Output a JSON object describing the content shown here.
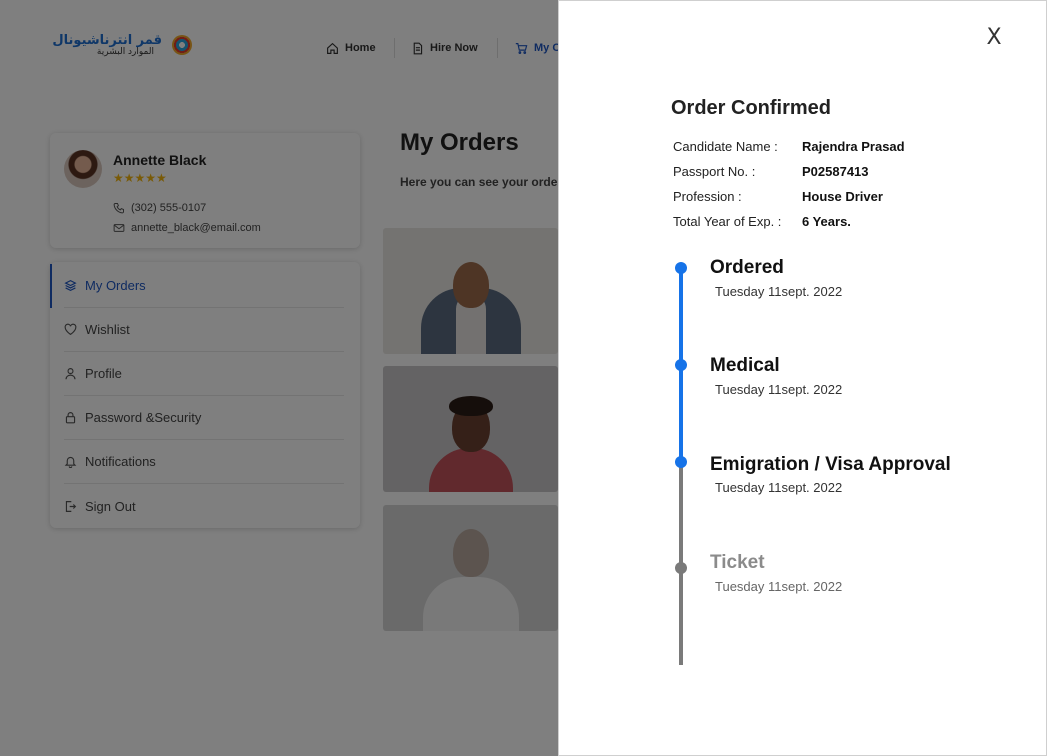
{
  "nav": {
    "logo_text_line1": "قمر انترناشيونال",
    "logo_text_line2": "الموارد البشرية",
    "items": [
      {
        "label": "Home",
        "icon": "home-icon"
      },
      {
        "label": "Hire Now",
        "icon": "document-icon"
      },
      {
        "label": "My O",
        "icon": "cart-icon"
      }
    ]
  },
  "profile": {
    "name": "Annette Black",
    "stars": "★★★★★",
    "phone": "(302) 555-0107",
    "email": "annette_black@email.com"
  },
  "sidebar": {
    "items": [
      {
        "label": "My Orders",
        "icon": "layers-icon",
        "active": true
      },
      {
        "label": "Wishlist",
        "icon": "heart-icon",
        "active": false
      },
      {
        "label": "Profile",
        "icon": "user-icon",
        "active": false
      },
      {
        "label": "Password &Security",
        "icon": "lock-icon",
        "active": false
      },
      {
        "label": "Notifications",
        "icon": "bell-icon",
        "active": false
      },
      {
        "label": "Sign Out",
        "icon": "sign-out-icon",
        "active": false
      }
    ]
  },
  "main": {
    "title": "My Orders",
    "subtitle": "Here you can see your orde"
  },
  "drawer": {
    "close_label": "X",
    "title": "Order Confirmed",
    "details": [
      {
        "label": "Candidate Name :",
        "value": "Rajendra Prasad"
      },
      {
        "label": "Passport No. :",
        "value": "P02587413"
      },
      {
        "label": "Profession :",
        "value": "House Driver"
      },
      {
        "label": "Total Year of Exp. :",
        "value": "6 Years."
      }
    ],
    "timeline": [
      {
        "title": "Ordered",
        "date": "Tuesday 11sept. 2022",
        "completed": true
      },
      {
        "title": "Medical",
        "date": "Tuesday 11sept. 2022",
        "completed": true
      },
      {
        "title": "Emigration / Visa Approval",
        "date": "Tuesday 11sept. 2022",
        "completed": true
      },
      {
        "title": "Ticket",
        "date": "Tuesday 11sept. 2022",
        "completed": false
      }
    ]
  },
  "colors": {
    "accent": "#1673e8",
    "inactive": "#7a7a7a",
    "star": "#f2b50f",
    "overlay": "rgba(0,0,0,0.5)"
  }
}
